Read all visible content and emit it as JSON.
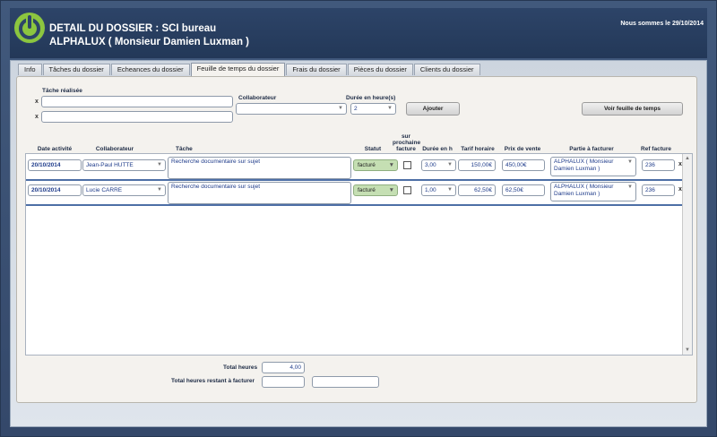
{
  "header": {
    "title_line1": "DETAIL DU DOSSIER : SCI bureau",
    "title_line2": "ALPHALUX ( Monsieur Damien Luxman )",
    "today": "Nous sommes le 29/10/2014"
  },
  "tabs": [
    {
      "label": "Info"
    },
    {
      "label": "Tâches du dossier"
    },
    {
      "label": "Echeances du dossier"
    },
    {
      "label": "Feuille de temps du dossier",
      "active": true
    },
    {
      "label": "Frais du dossier"
    },
    {
      "label": "Pièces du dossier"
    },
    {
      "label": "Clients du dossier"
    }
  ],
  "form": {
    "tache_label": "Tâche réalisée",
    "collab_label": "Collaborateur",
    "duree_label": "Durée en heure(s)",
    "duree_value": "2",
    "add_button": "Ajouter",
    "view_button": "Voir feuille de temps",
    "clear_mark": "x"
  },
  "columns": {
    "date": "Date activité",
    "collab": "Collaborateur",
    "tache": "Tâche",
    "statut": "Statut",
    "prochaine": "sur prochaine facture",
    "duree": "Durée en h",
    "tarif": "Tarif horaire",
    "prix": "Prix de vente",
    "partie": "Partie à facturer",
    "ref": "Ref facture"
  },
  "rows": [
    {
      "date": "20/10/2014",
      "collab": "Jean-Paul HUTTE",
      "tache": "Recherche documentaire sur sujet",
      "statut": "facturé",
      "duree": "3,00",
      "tarif": "150,00€",
      "prix": "450,00€",
      "partie": "ALPHALUX ( Monsieur Damien Luxman )",
      "ref": "236",
      "remove": "x"
    },
    {
      "date": "20/10/2014",
      "collab": "Lucie CARRE",
      "tache": "Recherche documentaire sur sujet",
      "statut": "facturé",
      "duree": "1,00",
      "tarif": "62,50€",
      "prix": "62,50€",
      "partie": "ALPHALUX ( Monsieur Damien Luxman )",
      "ref": "236",
      "remove": "x"
    }
  ],
  "totals": {
    "heures_label": "Total heures",
    "heures_value": "4,00",
    "restant_label": "Total heures restant à facturer"
  },
  "colors": {
    "header_bg": "#2d4468",
    "logo_green": "#8cc63f",
    "status_green": "#c5dfb3",
    "row_divider": "#4d6fa6"
  }
}
